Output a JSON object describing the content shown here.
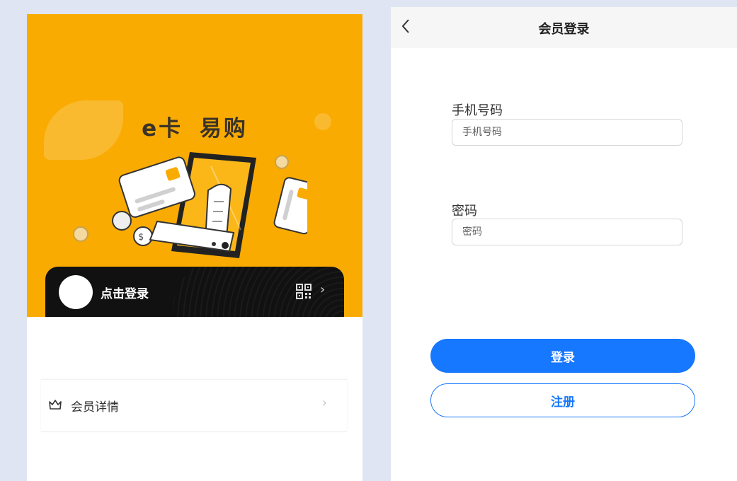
{
  "colors": {
    "brand_yellow": "#f9ab02",
    "card_black": "#111111",
    "primary_blue": "#1677ff",
    "page_bg": "#dfe5f2"
  },
  "home": {
    "banner_title": "e卡 易购",
    "member_card": {
      "login_text": "点击登录",
      "qr_icon": "qr-code-icon",
      "chevron": "›"
    },
    "menu": {
      "item_label": "会员详情",
      "item_icon": "crown-icon",
      "chevron": "›"
    }
  },
  "login": {
    "nav": {
      "title": "会员登录",
      "back_icon": "chevron-left-icon"
    },
    "phone": {
      "label": "手机号码",
      "placeholder": "手机号码",
      "value": ""
    },
    "password": {
      "label": "密码",
      "placeholder": "密码",
      "value": ""
    },
    "login_button": "登录",
    "register_button": "注册"
  }
}
